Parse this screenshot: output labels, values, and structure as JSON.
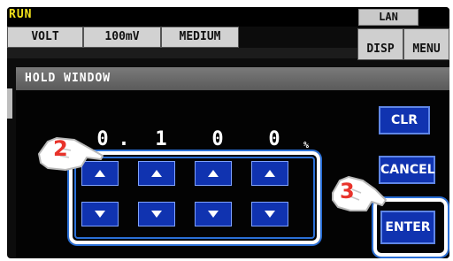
{
  "status": {
    "run": "RUN",
    "lan": "LAN"
  },
  "tabs": [
    {
      "label": "VOLT"
    },
    {
      "label": "100mV"
    },
    {
      "label": "MEDIUM"
    }
  ],
  "right_buttons": {
    "disp": "DISP",
    "menu": "MENU"
  },
  "dialog": {
    "title": "HOLD WINDOW",
    "digits": [
      "0",
      ".",
      "1",
      "0",
      "0"
    ],
    "unit": "%"
  },
  "side_buttons": {
    "clr": "CLR",
    "cancel": "CANCEL",
    "enter": "ENTER"
  },
  "callouts": {
    "step2": "2",
    "step3": "3"
  },
  "colors": {
    "button_blue": "#1033b0",
    "run_yellow": "#f2e21b",
    "callout_red": "#e8332b"
  },
  "icons": {
    "up": "triangle-up-icon",
    "down": "triangle-down-icon",
    "hand": "pointing-hand-icon"
  }
}
